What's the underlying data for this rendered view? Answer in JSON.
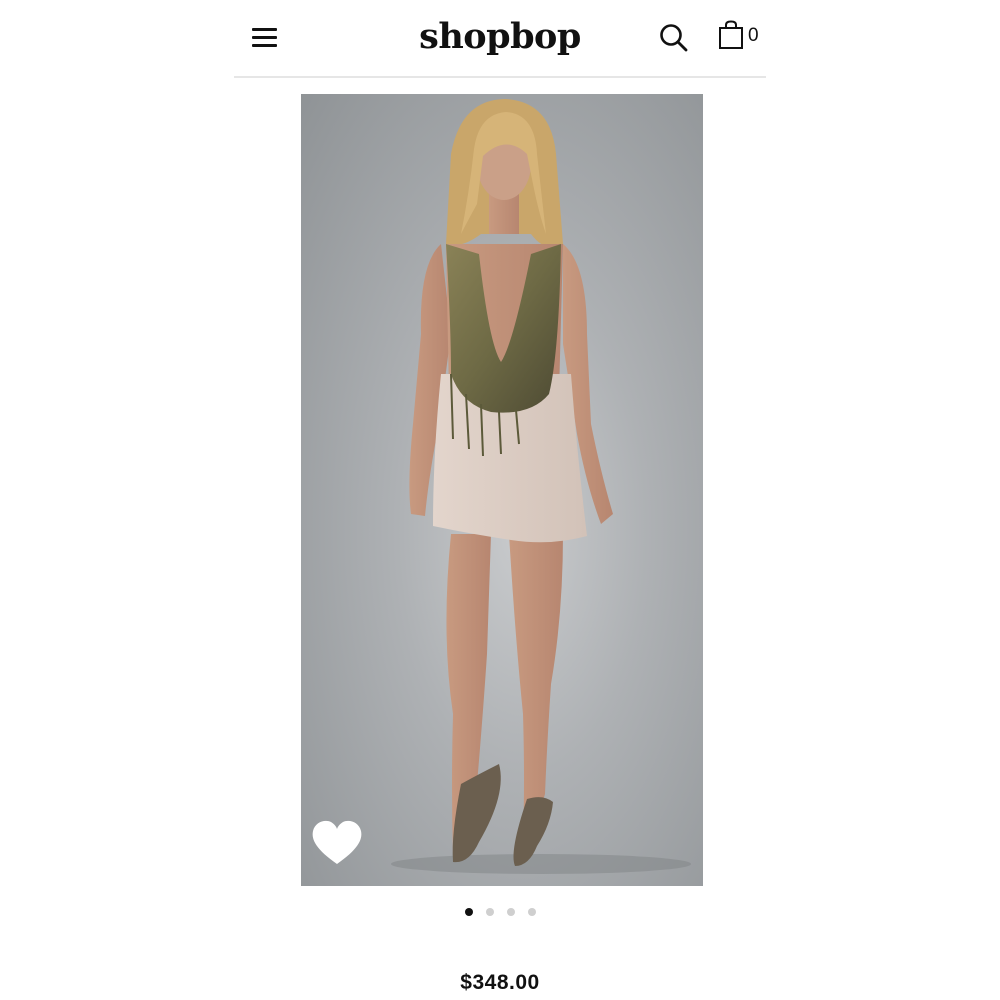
{
  "header": {
    "logo": "shopbop",
    "cart_count": "0",
    "icons": {
      "menu": "hamburger-menu-icon",
      "search": "search-icon",
      "bag": "shopping-bag-icon"
    }
  },
  "product": {
    "price": "$348.00",
    "image_icons": {
      "wishlist": "heart-icon"
    }
  },
  "carousel": {
    "total_slides": 4,
    "active_slide": 1
  },
  "colors": {
    "text": "#111111",
    "divider": "#e6e6e6",
    "dot_inactive": "#cfcfcf",
    "dot_active": "#111111",
    "heart": "#ffffff"
  }
}
